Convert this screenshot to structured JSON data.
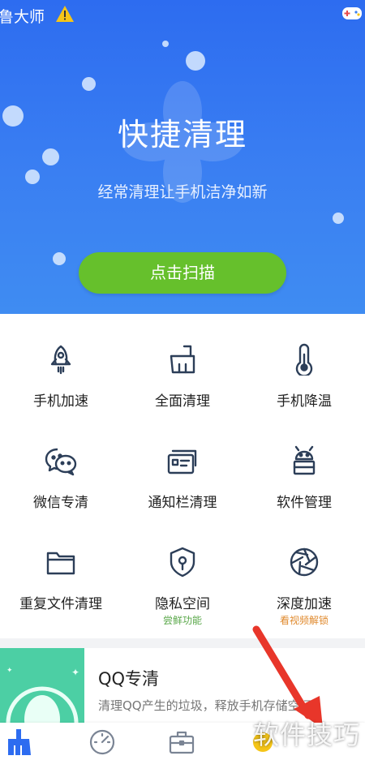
{
  "status_bar": {
    "app_name": "鲁大师"
  },
  "hero": {
    "title": "快捷清理",
    "subtitle": "经常清理让手机洁净如新",
    "scan_button": "点击扫描"
  },
  "features": [
    {
      "label": "手机加速",
      "icon": "rocket-icon"
    },
    {
      "label": "全面清理",
      "icon": "broom-icon"
    },
    {
      "label": "手机降温",
      "icon": "thermometer-icon"
    },
    {
      "label": "微信专清",
      "icon": "wechat-icon"
    },
    {
      "label": "通知栏清理",
      "icon": "notification-card-icon"
    },
    {
      "label": "软件管理",
      "icon": "android-icon"
    },
    {
      "label": "重复文件清理",
      "icon": "folder-icon"
    },
    {
      "label": "隐私空间",
      "icon": "shield-lock-icon",
      "tag": "尝鲜功能",
      "tag_color": "#5aa84a"
    },
    {
      "label": "深度加速",
      "icon": "aperture-icon",
      "tag": "看视频解锁",
      "tag_color": "#e08a2e"
    }
  ],
  "qq_card": {
    "title": "QQ专清",
    "description": "清理QQ产生的垃圾，释放手机存储空间"
  },
  "tabs": [
    {
      "icon": "broom-tab-icon",
      "active": true
    },
    {
      "icon": "speedometer-icon",
      "active": false
    },
    {
      "icon": "toolbox-icon",
      "active": false
    },
    {
      "icon": "user-tab-icon",
      "active": false
    }
  ],
  "watermark": "软件技巧",
  "colors": {
    "accent_blue": "#2d6cf0",
    "button_green": "#66c02c",
    "icon_dark": "#2c3e58"
  }
}
